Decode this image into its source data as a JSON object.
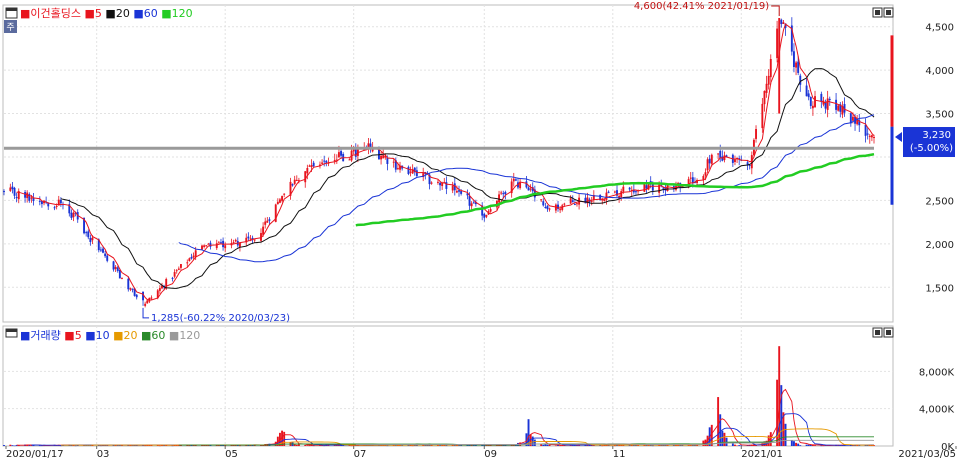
{
  "price_panel": {
    "legend": {
      "name": "이건홀딩스",
      "ma": [
        "5",
        "20",
        "60",
        "120"
      ]
    },
    "max_annotation": "4,600(42.41% 2021/01/19)",
    "min_annotation": "1,285(-60.22% 2020/03/23)",
    "current_price": "3,230",
    "current_change": "(-5.00%)"
  },
  "volume_panel": {
    "legend": {
      "name": "거래량",
      "ma": [
        "5",
        "10",
        "20",
        "60",
        "120"
      ]
    }
  },
  "x_axis_labels": [
    "2020/01/17",
    "03",
    "05",
    "07",
    "09",
    "11",
    "2021/01",
    "2021/03/05"
  ],
  "colors": {
    "up": "#e8141e",
    "down": "#1a34d6",
    "ma5": "#e8141e",
    "ma20": "#111111",
    "ma60": "#1a34d6",
    "ma120": "#22cc22",
    "vma10": "#1a34d6",
    "vma20": "#e69a00",
    "vma60": "#2a8a2a",
    "vma120": "#9a9a9a"
  },
  "chart_data": [
    {
      "type": "candlestick",
      "title": "이건홀딩스",
      "y_ticks": [
        1500,
        2000,
        2500,
        3000,
        3500,
        4000,
        4500
      ],
      "y_range": [
        1100,
        4750
      ],
      "horizontal_line": 3100,
      "series_names": [
        "5",
        "20",
        "60",
        "120"
      ],
      "key_points": [
        {
          "date": "2020/01/17",
          "close": 2600
        },
        {
          "date": "2020/02/15",
          "close": 2450
        },
        {
          "date": "2020/03/23",
          "close": 1285,
          "label": "min"
        },
        {
          "date": "2020/04/20",
          "close": 1980
        },
        {
          "date": "2020/05/15",
          "close": 2050
        },
        {
          "date": "2020/05/28",
          "close": 2550
        },
        {
          "date": "2020/06/10",
          "close": 2900
        },
        {
          "date": "2020/07/10",
          "close": 3100
        },
        {
          "date": "2020/07/25",
          "close": 2850
        },
        {
          "date": "2020/08/20",
          "close": 2600
        },
        {
          "date": "2020/09/01",
          "close": 2300
        },
        {
          "date": "2020/09/15",
          "close": 2750
        },
        {
          "date": "2020/10/01",
          "close": 2400
        },
        {
          "date": "2020/11/01",
          "close": 2600
        },
        {
          "date": "2020/12/10",
          "close": 2700
        },
        {
          "date": "2020/12/20",
          "close": 3050
        },
        {
          "date": "2021/01/05",
          "close": 2900
        },
        {
          "date": "2021/01/19",
          "close": 4600,
          "label": "max"
        },
        {
          "date": "2021/02/01",
          "close": 3700
        },
        {
          "date": "2021/02/20",
          "close": 3500
        },
        {
          "date": "2021/03/05",
          "close": 3230
        }
      ]
    },
    {
      "type": "bar",
      "title": "거래량",
      "y_ticks": [
        0,
        4000,
        8000
      ],
      "y_tick_labels": [
        "0K",
        "4,000K",
        "8,000K"
      ],
      "y_range": [
        0,
        12000
      ],
      "series_names": [
        "5",
        "10",
        "20",
        "60",
        "120"
      ],
      "peaks": [
        {
          "date": "2020/05/28",
          "volume": 2600
        },
        {
          "date": "2020/09/22",
          "volume": 2800
        },
        {
          "date": "2020/12/20",
          "volume": 8700
        },
        {
          "date": "2021/01/19",
          "volume": 11400
        }
      ]
    }
  ]
}
